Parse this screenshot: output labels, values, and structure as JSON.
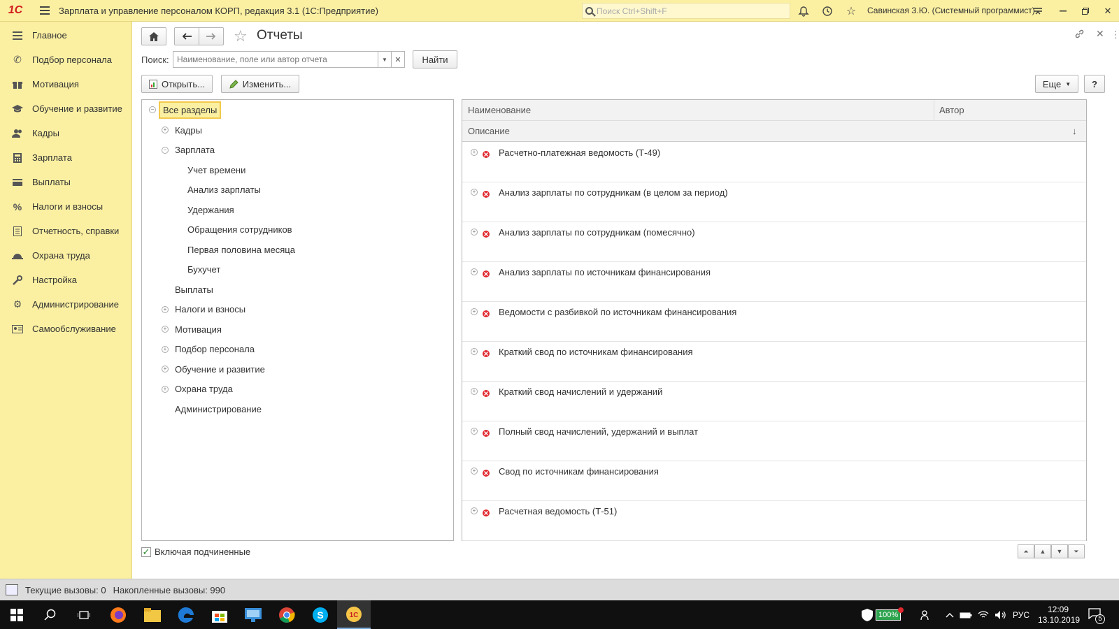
{
  "titlebar": {
    "logo": "1С",
    "app_title": "Зарплата и управление персоналом КОРП, редакция 3.1  (1С:Предприятие)",
    "search_placeholder": "Поиск Ctrl+Shift+F",
    "user": "Савинская З.Ю. (Системный программист)"
  },
  "sidebar": {
    "items": [
      {
        "label": "Главное",
        "icon": "menu-icon"
      },
      {
        "label": "Подбор персонала",
        "icon": "phone-icon"
      },
      {
        "label": "Мотивация",
        "icon": "gift-icon"
      },
      {
        "label": "Обучение и развитие",
        "icon": "graduation-cap-icon"
      },
      {
        "label": "Кадры",
        "icon": "people-icon"
      },
      {
        "label": "Зарплата",
        "icon": "calculator-icon"
      },
      {
        "label": "Выплаты",
        "icon": "wallet-icon"
      },
      {
        "label": "Налоги и взносы",
        "icon": "percent-icon"
      },
      {
        "label": "Отчетность, справки",
        "icon": "document-icon"
      },
      {
        "label": "Охрана труда",
        "icon": "helmet-icon"
      },
      {
        "label": "Настройка",
        "icon": "wrench-icon"
      },
      {
        "label": "Администрирование",
        "icon": "gear-icon"
      },
      {
        "label": "Самообслуживание",
        "icon": "id-card-icon"
      }
    ]
  },
  "page": {
    "title": "Отчеты",
    "search_label": "Поиск:",
    "search_placeholder": "Наименование, поле или автор отчета",
    "find_button": "Найти",
    "open_button": "Открыть...",
    "edit_button": "Изменить...",
    "more_button": "Еще",
    "help_button": "?",
    "include_children_label": "Включая подчиненные",
    "include_children_checked": true
  },
  "tree": {
    "root": "Все разделы",
    "items": [
      {
        "label": "Кадры",
        "level": 1,
        "toggle": "⊕"
      },
      {
        "label": "Зарплата",
        "level": 1,
        "toggle": "⊖"
      },
      {
        "label": "Учет времени",
        "level": 2,
        "toggle": ""
      },
      {
        "label": "Анализ зарплаты",
        "level": 2,
        "toggle": ""
      },
      {
        "label": "Удержания",
        "level": 2,
        "toggle": ""
      },
      {
        "label": "Обращения сотрудников",
        "level": 2,
        "toggle": ""
      },
      {
        "label": "Первая половина месяца",
        "level": 2,
        "toggle": ""
      },
      {
        "label": "Бухучет",
        "level": 2,
        "toggle": ""
      },
      {
        "label": "Выплаты",
        "level": 1,
        "toggle": ""
      },
      {
        "label": "Налоги и взносы",
        "level": 1,
        "toggle": "⊕"
      },
      {
        "label": "Мотивация",
        "level": 1,
        "toggle": "⊕"
      },
      {
        "label": "Подбор персонала",
        "level": 1,
        "toggle": "⊕"
      },
      {
        "label": "Обучение и развитие",
        "level": 1,
        "toggle": "⊕"
      },
      {
        "label": "Охрана труда",
        "level": 1,
        "toggle": "⊕"
      },
      {
        "label": "Администрирование",
        "level": 1,
        "toggle": ""
      }
    ]
  },
  "grid": {
    "columns": {
      "name": "Наименование",
      "author": "Автор",
      "description": "Описание",
      "sort_indicator": "↓"
    },
    "rows": [
      "Расчетно-платежная ведомость (Т-49)",
      "Анализ зарплаты по сотрудникам (в целом за период)",
      "Анализ зарплаты по сотрудникам (помесячно)",
      "Анализ зарплаты по источникам финансирования",
      "Ведомости с разбивкой по источникам финансирования",
      "Краткий свод по источникам финансирования",
      "Краткий свод начислений и удержаний",
      "Полный свод начислений, удержаний и выплат",
      "Свод по источникам финансирования",
      "Расчетная ведомость (Т-51)"
    ]
  },
  "statusbar": {
    "current_calls": "Текущие вызовы: 0",
    "accumulated_calls": "Накопленные вызовы: 990"
  },
  "taskbar": {
    "battery": "100%",
    "lang": "РУС",
    "time": "12:09",
    "date": "13.10.2019",
    "notifications": "5"
  },
  "colors": {
    "accent_yellow": "#fbf0a2",
    "selection_border": "#f2c94c",
    "brand_red": "#d11c1c"
  }
}
